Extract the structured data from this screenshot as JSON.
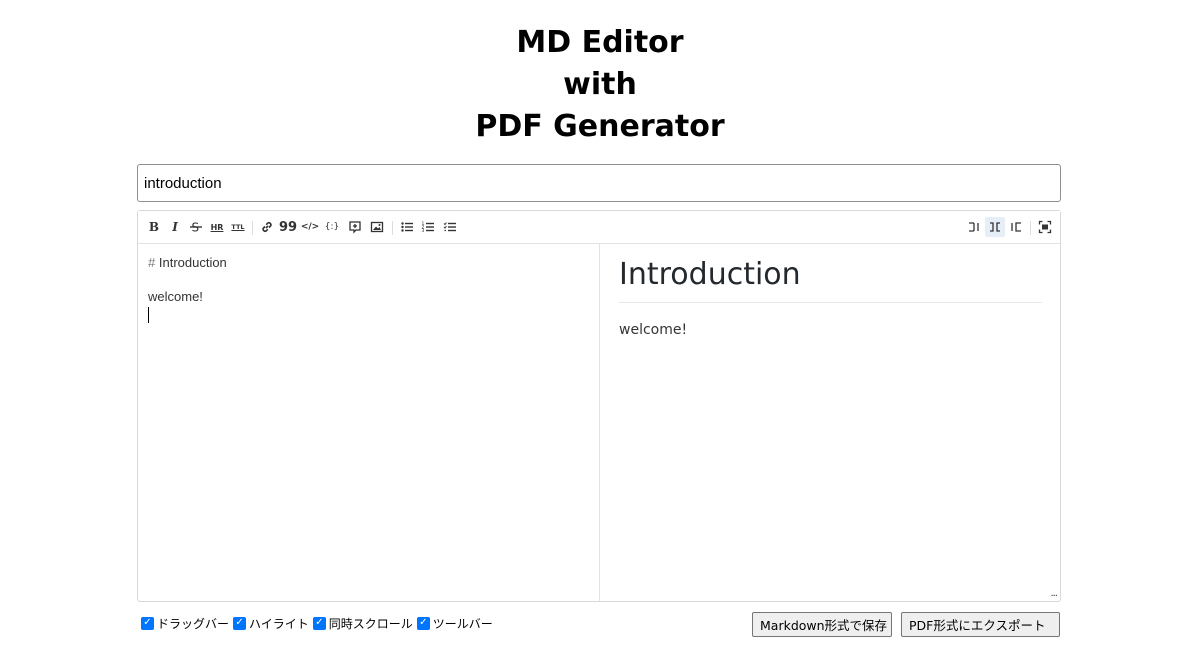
{
  "header": {
    "title_lines": [
      "MD Editor",
      "with",
      "PDF Generator"
    ]
  },
  "filename": {
    "value": "introduction"
  },
  "toolbar": {
    "left_icons": [
      "bold-icon",
      "italic-icon",
      "strikethrough-icon",
      "hr-icon",
      "title-icon",
      "link-icon",
      "quote-icon",
      "code-icon",
      "code-block-icon",
      "comment-icon",
      "image-icon",
      "unordered-list-icon",
      "ordered-list-icon",
      "task-list-icon"
    ],
    "right_icons": [
      "editor-only-icon",
      "split-view-icon",
      "preview-only-icon",
      "fullscreen-icon"
    ],
    "bold": "B",
    "italic": "I",
    "hr": "HR",
    "title": "TTL",
    "quote": "99",
    "code": "</>",
    "code_block": "{:}"
  },
  "editor": {
    "lines": [
      "# Introduction",
      "",
      "welcome!"
    ],
    "hash": "#",
    "heading_text": "Introduction",
    "body_text": "welcome!"
  },
  "preview": {
    "h1": "Introduction",
    "p": "welcome!",
    "resize_handle": "..."
  },
  "options": {
    "items": [
      {
        "label": "ドラッグバー",
        "checked": true
      },
      {
        "label": "ハイライト",
        "checked": true
      },
      {
        "label": "同時スクロール",
        "checked": true
      },
      {
        "label": "ツールバー",
        "checked": true
      }
    ]
  },
  "actions": {
    "save_label": "Markdown形式で保存",
    "pdf_label": "PDF形式にエクスポート"
  },
  "colors": {
    "checkbox": "#0075ff",
    "active_toolbar": "#e6eef8"
  }
}
